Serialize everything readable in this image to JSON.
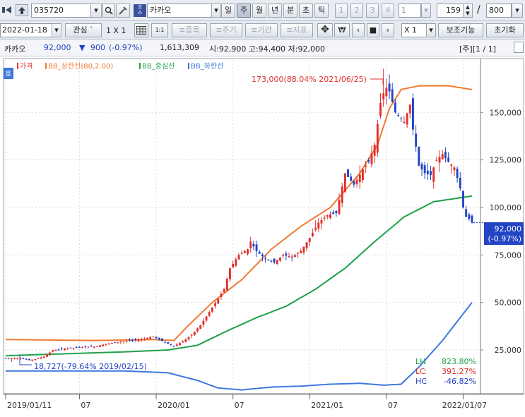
{
  "toolbar": {
    "code": "035720",
    "stock_name": "카카오",
    "periods": [
      "일",
      "주",
      "월",
      "년",
      "분",
      "초",
      "틱"
    ],
    "active_period": "주",
    "nums": [
      "1",
      "2",
      "3",
      "4"
    ],
    "interval_value": "1",
    "count_value": "159",
    "slash": "/",
    "total_value": "800",
    "date_value": "2022-01-18",
    "watch_label": "관심",
    "watch_suffix": "`",
    "layout_label": "1 X 1",
    "range_label": "1:1",
    "item_label": "≡종목",
    "cycle_label": "≡주기",
    "period_label": "≡기간",
    "indicator_label": "≡지표",
    "won_label": "₩",
    "multiply_value": "X  1",
    "aux_label": "보조기능",
    "reset_label": "초기화"
  },
  "info": {
    "name": "카카오",
    "price": "92,000",
    "change_arrow": "▼",
    "change": "900",
    "change_pct": "(-0.97%)",
    "volume": "1,613,309",
    "ohl": "시:92,900 고:94,400 저:92,000",
    "page": "[주][1 / 1]"
  },
  "legend": {
    "toggle": "호",
    "items": [
      "가격",
      "BB_상한선(80,2.00)",
      "BB_중심선",
      "BB_하한선"
    ]
  },
  "annotations": {
    "high": "173,000(88.04% 2021/06/25)",
    "low": "18,727(-79.64% 2019/02/15)"
  },
  "price_badge": {
    "price": "92,000",
    "pct": "(-0.97%)"
  },
  "stats": [
    {
      "key": "LH",
      "value": "823.80%"
    },
    {
      "key": "LC",
      "value": "391.27%"
    },
    {
      "key": "HC",
      "value": "-46.82%"
    }
  ],
  "colors": {
    "up": "#e0302c",
    "down": "#2344c4",
    "upper": "#f07a32",
    "middle": "#1ea04a",
    "lower": "#3d78e0",
    "stat_lh": "#1ea04a",
    "stat_lc": "#e0302c",
    "stat_hc": "#2344c4"
  },
  "chart_data": {
    "type": "candlestick",
    "y_ticks": [
      25000,
      50000,
      75000,
      100000,
      125000,
      150000
    ],
    "y_tick_labels": [
      "25,000",
      "50,000",
      "75,000",
      "100,000",
      "125,000",
      "150,000"
    ],
    "ylim": [
      2000,
      172000
    ],
    "x_ticks": [
      {
        "label": "2019/01/11",
        "i": 0
      },
      {
        "label": "07",
        "i": 25
      },
      {
        "label": "2020/01",
        "i": 51
      },
      {
        "label": "07",
        "i": 77
      },
      {
        "label": "2021/01",
        "i": 103
      },
      {
        "label": "07",
        "i": 129
      },
      {
        "label": "2022/01/07",
        "i": 155
      }
    ],
    "n": 159,
    "close_anchors": [
      [
        0,
        20800
      ],
      [
        5,
        20600
      ],
      [
        8,
        19600
      ],
      [
        10,
        20200
      ],
      [
        13,
        21500
      ],
      [
        16,
        24800
      ],
      [
        20,
        25700
      ],
      [
        25,
        26500
      ],
      [
        30,
        26800
      ],
      [
        35,
        28500
      ],
      [
        40,
        29600
      ],
      [
        45,
        30300
      ],
      [
        50,
        32000
      ],
      [
        54,
        29000
      ],
      [
        57,
        27000
      ],
      [
        60,
        29500
      ],
      [
        63,
        33000
      ],
      [
        66,
        38000
      ],
      [
        69,
        45000
      ],
      [
        72,
        52000
      ],
      [
        74,
        57000
      ],
      [
        76,
        68000
      ],
      [
        79,
        75000
      ],
      [
        82,
        78000
      ],
      [
        83,
        82000
      ],
      [
        85,
        77000
      ],
      [
        88,
        73000
      ],
      [
        91,
        71000
      ],
      [
        94,
        75000
      ],
      [
        97,
        74000
      ],
      [
        100,
        77000
      ],
      [
        103,
        84000
      ],
      [
        106,
        92000
      ],
      [
        109,
        96000
      ],
      [
        112,
        97000
      ],
      [
        115,
        118000
      ],
      [
        118,
        112000
      ],
      [
        121,
        120000
      ],
      [
        123,
        124000
      ],
      [
        125,
        133000
      ],
      [
        127,
        155000
      ],
      [
        128,
        160000
      ],
      [
        129,
        163000
      ],
      [
        130,
        161000
      ],
      [
        132,
        150000
      ],
      [
        135,
        145000
      ],
      [
        137,
        154000
      ],
      [
        138,
        141000
      ],
      [
        139,
        132000
      ],
      [
        140,
        122000
      ],
      [
        142,
        118000
      ],
      [
        144,
        117000
      ],
      [
        146,
        125000
      ],
      [
        148,
        128000
      ],
      [
        150,
        124000
      ],
      [
        152,
        121000
      ],
      [
        154,
        110000
      ],
      [
        155,
        100000
      ],
      [
        156,
        95000
      ],
      [
        157,
        94000
      ],
      [
        158,
        92000
      ]
    ],
    "upper_anchors": [
      [
        0,
        30500
      ],
      [
        30,
        30000
      ],
      [
        50,
        30500
      ],
      [
        57,
        30000
      ],
      [
        62,
        38000
      ],
      [
        70,
        50000
      ],
      [
        80,
        62000
      ],
      [
        90,
        78000
      ],
      [
        100,
        90000
      ],
      [
        110,
        100000
      ],
      [
        120,
        118000
      ],
      [
        126,
        133000
      ],
      [
        130,
        152000
      ],
      [
        134,
        162000
      ],
      [
        140,
        164000
      ],
      [
        150,
        164000
      ],
      [
        158,
        162000
      ]
    ],
    "middle_anchors": [
      [
        0,
        22000
      ],
      [
        20,
        23000
      ],
      [
        40,
        24000
      ],
      [
        55,
        25000
      ],
      [
        65,
        27500
      ],
      [
        75,
        35000
      ],
      [
        85,
        42000
      ],
      [
        95,
        48000
      ],
      [
        105,
        57000
      ],
      [
        115,
        68000
      ],
      [
        125,
        82000
      ],
      [
        135,
        95000
      ],
      [
        145,
        103000
      ],
      [
        158,
        106000
      ]
    ],
    "lower_anchors": [
      [
        0,
        14000
      ],
      [
        20,
        14000
      ],
      [
        40,
        14000
      ],
      [
        55,
        13000
      ],
      [
        65,
        9000
      ],
      [
        72,
        5000
      ],
      [
        80,
        4000
      ],
      [
        90,
        5500
      ],
      [
        100,
        6000
      ],
      [
        110,
        7000
      ],
      [
        120,
        7500
      ],
      [
        128,
        6500
      ],
      [
        134,
        7000
      ],
      [
        140,
        16000
      ],
      [
        148,
        30000
      ],
      [
        154,
        42000
      ],
      [
        158,
        50000
      ]
    ],
    "high_point": {
      "i": 128,
      "value": 173000
    },
    "low_point": {
      "i": 2,
      "value": 18727
    },
    "last": {
      "i": 158,
      "value": 92000
    }
  }
}
